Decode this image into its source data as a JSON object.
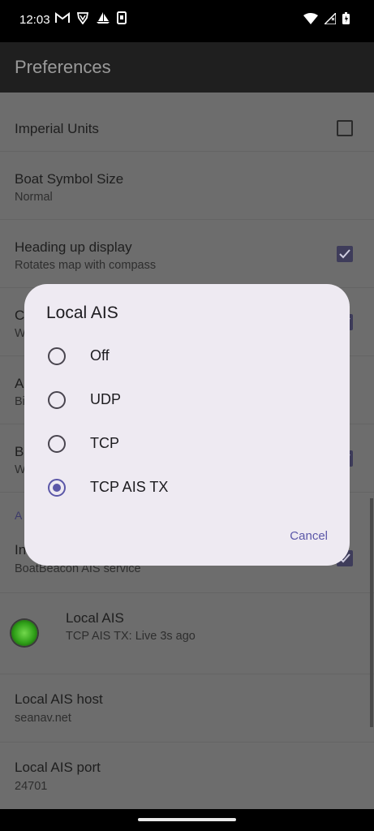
{
  "status_bar": {
    "time": "12:03",
    "left_icons": [
      "gmail-icon",
      "vpn-shield-icon",
      "sailboat-icon",
      "device-icon"
    ],
    "right_icons": [
      "wifi-icon",
      "cell-signal-icon",
      "battery-icon"
    ]
  },
  "app_bar": {
    "title": "Preferences"
  },
  "preferences": {
    "imperial_units": {
      "title": "Imperial Units",
      "checked": false
    },
    "boat_symbol_size": {
      "title": "Boat Symbol Size",
      "summary": "Normal"
    },
    "heading_up": {
      "title": "Heading up display",
      "summary": "Rotates map with compass",
      "checked": true
    },
    "partial_row_1": {
      "title": "C",
      "summary": "W",
      "checked": true
    },
    "partial_row_2": {
      "title": "A",
      "summary": "Bi"
    },
    "partial_row_3": {
      "title": "B",
      "summary": "W",
      "checked": true
    },
    "section_header": "A",
    "ais_service": {
      "title": "In",
      "summary": "BoatBeacon AIS service",
      "checked": true
    },
    "local_ais": {
      "title": "Local AIS",
      "summary": "TCP AIS TX: Live 3s  ago"
    },
    "local_ais_host": {
      "title": "Local AIS host",
      "summary": "seanav.net"
    },
    "local_ais_port": {
      "title": "Local AIS port",
      "summary": "24701"
    }
  },
  "dialog": {
    "title": "Local AIS",
    "options": [
      {
        "label": "Off",
        "selected": false
      },
      {
        "label": "UDP",
        "selected": false
      },
      {
        "label": "TCP",
        "selected": false
      },
      {
        "label": "TCP AIS TX",
        "selected": true
      }
    ],
    "cancel_label": "Cancel"
  },
  "colors": {
    "accent": "#5b57a8",
    "dialog_bg": "#eeeaf2",
    "scrim_list_bg": "#6d6d6d",
    "checkbox_checked": "#3e3c5a",
    "status_light": "#2fa018"
  }
}
